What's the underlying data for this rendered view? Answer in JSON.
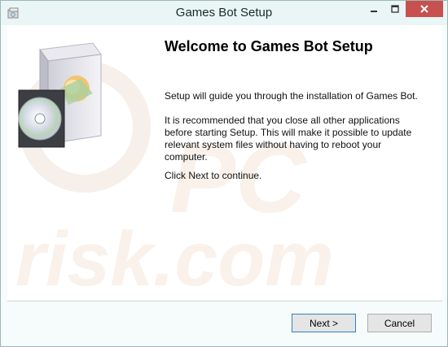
{
  "window": {
    "title": "Games Bot Setup",
    "icons": {
      "app": "installer-icon",
      "minimize": "minimize-icon",
      "maximize": "maximize-icon",
      "close": "close-icon"
    }
  },
  "main": {
    "heading": "Welcome to Games Bot Setup",
    "paragraphs": [
      "Setup will guide you through the installation of Games Bot.",
      "It is recommended that you close all other applications before starting Setup. This will make it possible to update relevant system files without having to reboot your computer.",
      "Click Next to continue."
    ],
    "hero_image": "software-box-cd-icon"
  },
  "footer": {
    "next_label": "Next >",
    "cancel_label": "Cancel"
  },
  "colors": {
    "titlebar": "#eaf5f5",
    "close_button": "#c7514e",
    "content_bg": "#ffffff",
    "default_button_border": "#3c7fb1"
  }
}
